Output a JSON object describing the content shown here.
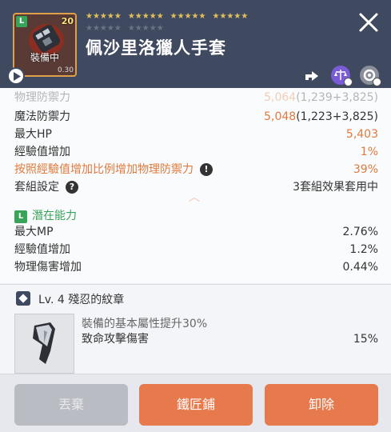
{
  "header": {
    "item_name": "佩沙里洛獵人手套",
    "item_level": "20",
    "grade_badge": "L",
    "equipped_label": "裝備中",
    "item_sub": "0.30",
    "stars_filled_groups": [
      "★★★★★",
      "★★★★★",
      "★★★★★",
      "★★★★★"
    ],
    "stars_empty_groups": [
      "★★★★★",
      "★★★★★"
    ],
    "icons": {
      "play": "play-icon",
      "close": "close-icon",
      "share": "share-icon",
      "scale": "scale-icon",
      "gear": "gear-icon"
    }
  },
  "stats": {
    "faded_row": {
      "label": "物理防禦力",
      "value": "5,064",
      "detail": "(1,239+3,825)"
    },
    "rows": [
      {
        "label": "魔法防禦力",
        "value": "5,048",
        "detail": "(1,223+3,825)"
      },
      {
        "label": "最大HP",
        "value": "5,403"
      },
      {
        "label": "經驗值增加",
        "value": "1%"
      },
      {
        "label": "按照經驗值增加比例增加物理防禦力",
        "value": "39%"
      },
      {
        "label": "套組設定",
        "value": "3套組效果套用中"
      }
    ],
    "potential": {
      "badge": "L",
      "title": "潛在能力",
      "rows": [
        {
          "label": "最大MP",
          "value": "2.76%"
        },
        {
          "label": "經驗值增加",
          "value": "1.2%"
        },
        {
          "label": "物理傷害增加",
          "value": "0.44%"
        }
      ]
    }
  },
  "emblem": {
    "title": "Lv. 4 殘忍的紋章",
    "description": "裝備的基本屬性提升30%",
    "stat_label": "致命攻擊傷害",
    "stat_value": "15%"
  },
  "footer": {
    "discard": "丟棄",
    "blacksmith": "鐵匠鋪",
    "unequip": "卸除"
  },
  "colors": {
    "header_bg": "#3f4a61",
    "accent_orange": "#e67a4c",
    "potential_green": "#3aa35a",
    "star_gold": "#e2bf5a"
  }
}
